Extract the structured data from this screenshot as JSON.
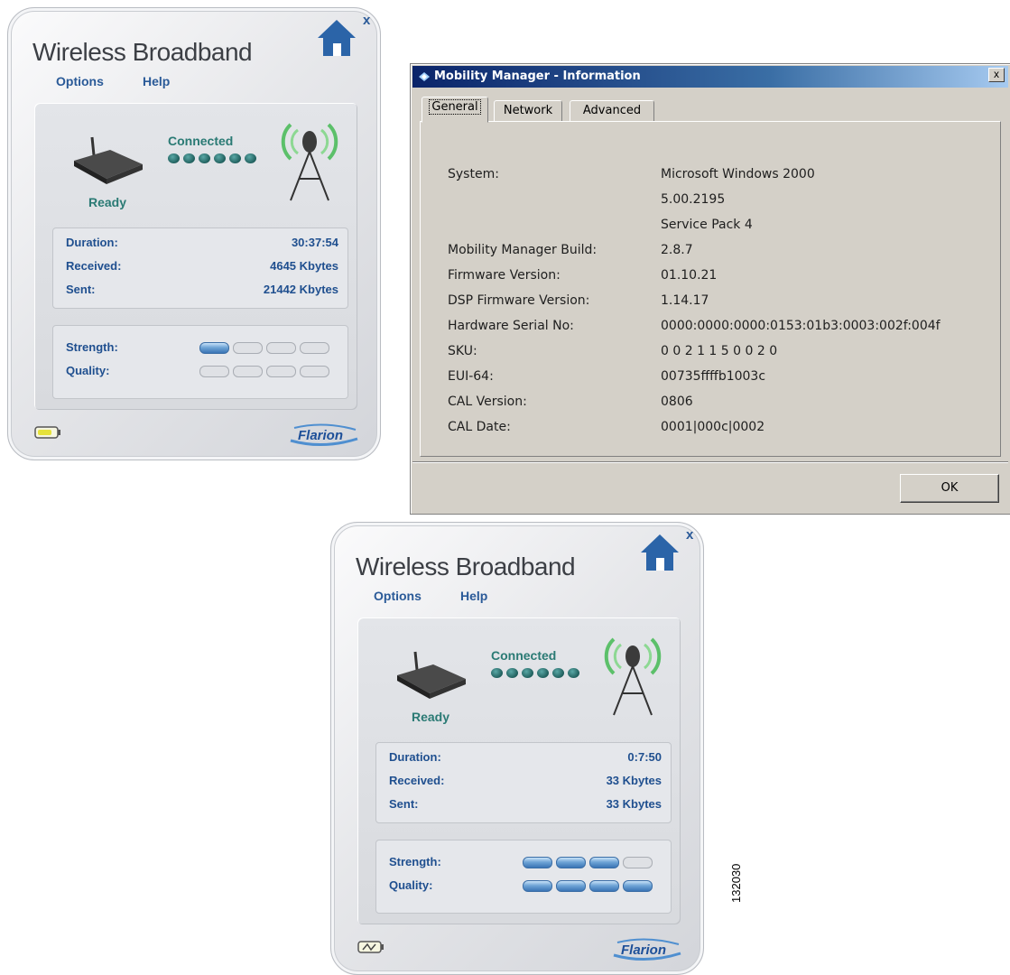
{
  "widget1": {
    "title": "Wireless Broadband",
    "menu": {
      "options": "Options",
      "help": "Help"
    },
    "close": "x",
    "status": "Connected",
    "device_state": "Ready",
    "stats": [
      {
        "label": "Duration:",
        "value": "30:37:54"
      },
      {
        "label": "Received:",
        "value": "4645 Kbytes"
      },
      {
        "label": "Sent:",
        "value": "21442 Kbytes"
      }
    ],
    "strength_label": "Strength:",
    "quality_label": "Quality:",
    "strength_level": 1,
    "quality_level": 0,
    "brand": "Flarion"
  },
  "widget2": {
    "title": "Wireless Broadband",
    "menu": {
      "options": "Options",
      "help": "Help"
    },
    "close": "x",
    "status": "Connected",
    "device_state": "Ready",
    "stats": [
      {
        "label": "Duration:",
        "value": "0:7:50"
      },
      {
        "label": "Received:",
        "value": "33 Kbytes"
      },
      {
        "label": "Sent:",
        "value": "33 Kbytes"
      }
    ],
    "strength_label": "Strength:",
    "quality_label": "Quality:",
    "strength_level": 3,
    "quality_level": 4,
    "brand": "Flarion"
  },
  "dialog": {
    "title": "Mobility Manager - Information",
    "close": "x",
    "tabs": [
      "General",
      "Network",
      "Advanced"
    ],
    "active_tab": "General",
    "rows": [
      {
        "label": "System:",
        "value": "Microsoft Windows 2000"
      },
      {
        "label": "",
        "value": "5.00.2195"
      },
      {
        "label": "",
        "value": "Service Pack 4"
      },
      {
        "label": "Mobility Manager Build:",
        "value": "2.8.7"
      },
      {
        "label": "Firmware Version:",
        "value": "01.10.21"
      },
      {
        "label": "DSP Firmware Version:",
        "value": "1.14.17"
      },
      {
        "label": "Hardware Serial No:",
        "value": "0000:0000:0000:0153:01b3:0003:002f:004f"
      },
      {
        "label": "SKU:",
        "value": "0 0 2 1 1 5 0 0 2 0"
      },
      {
        "label": "EUI-64:",
        "value": "00735ffffb1003c"
      },
      {
        "label": "CAL Version:",
        "value": "0806"
      },
      {
        "label": "CAL Date:",
        "value": "0001|000c|0002"
      }
    ],
    "ok_label": "OK"
  },
  "figure_id": "132030",
  "colors": {
    "label_blue": "#1f4f8f",
    "teal": "#2a7a74",
    "titlebar": "#0a246a"
  }
}
